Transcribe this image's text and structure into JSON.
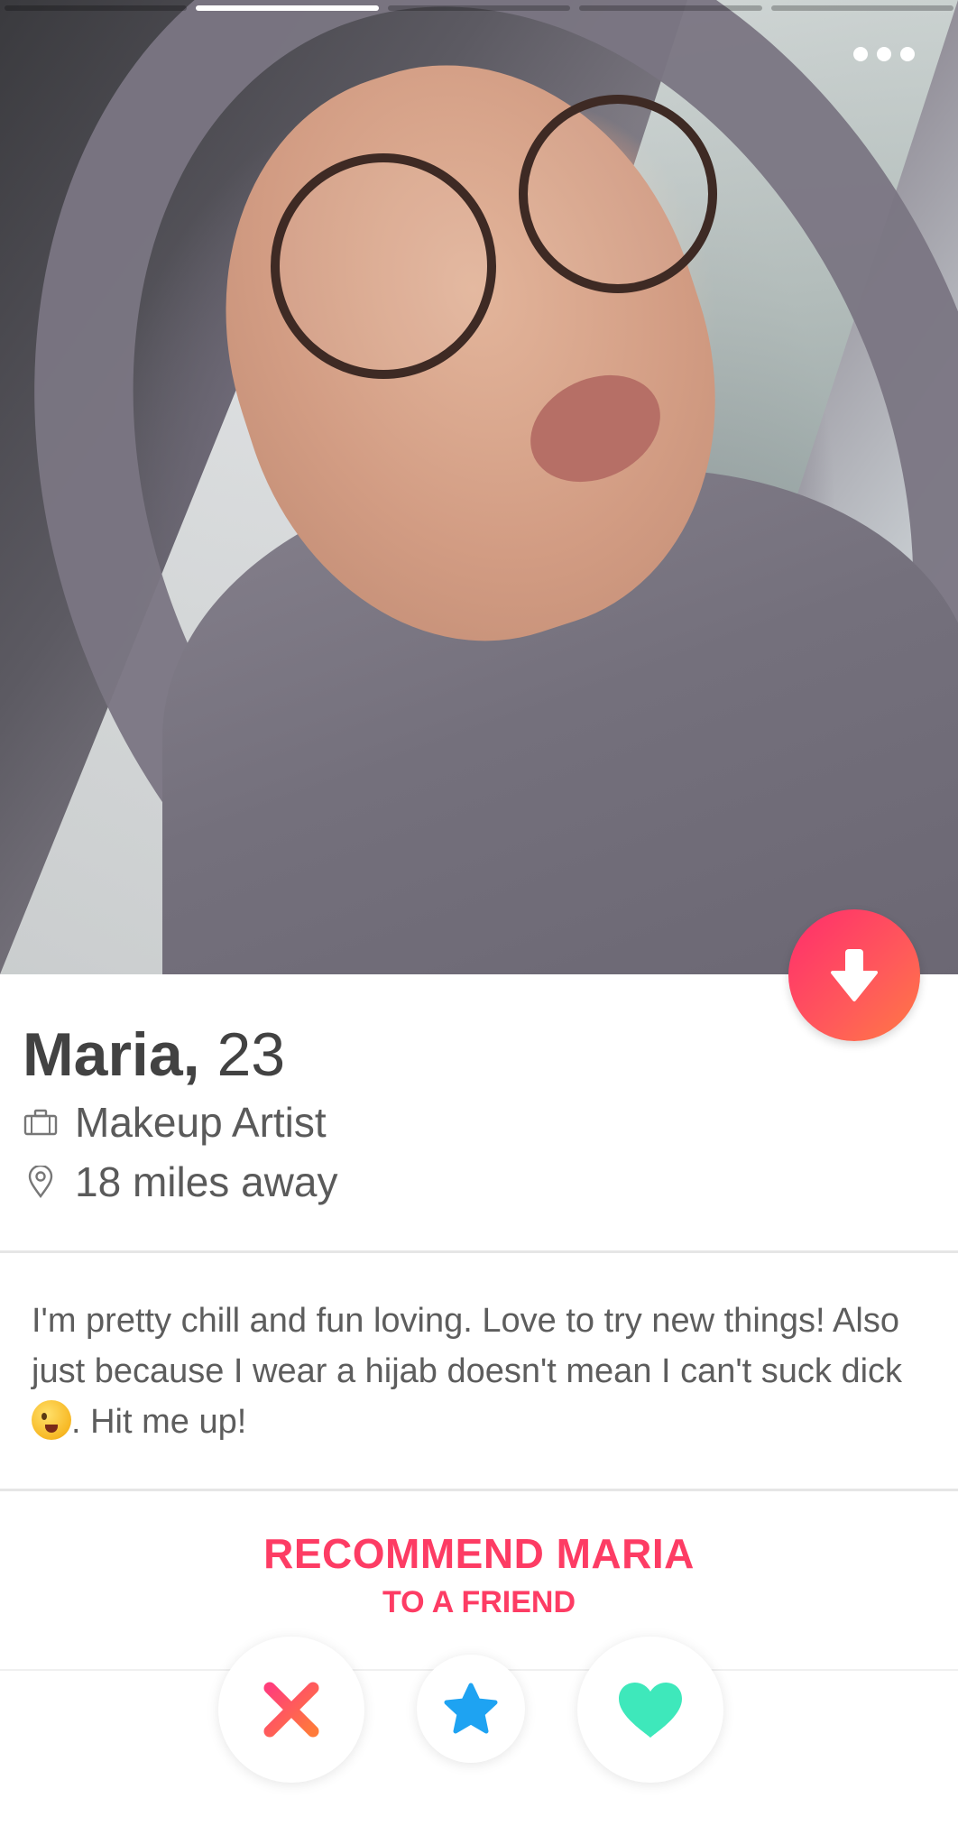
{
  "profile": {
    "name": "Maria,",
    "age": "23",
    "job": "Makeup Artist",
    "distance": "18 miles away",
    "bio_part1": "I'm pretty chill and fun loving. Love to try new things! Also just because I wear a hijab doesn't mean I can't suck dick ",
    "bio_emoji": "winking-face-emoji",
    "bio_part2": ". Hit me up!"
  },
  "photo_progress": {
    "total": 5,
    "active_index": 1
  },
  "recommend": {
    "line1": "RECOMMEND MARIA",
    "line2": "TO A FRIEND"
  },
  "icons": {
    "more": "ellipsis-icon",
    "collapse": "arrow-down-icon",
    "job": "briefcase-icon",
    "location": "location-pin-icon",
    "nope": "x-icon",
    "super_like": "star-icon",
    "like": "heart-icon"
  },
  "colors": {
    "brand_pink": "#fd3c64",
    "super_like_blue": "#1ea3f2",
    "like_teal": "#3ee8bb",
    "text_dark": "#424242",
    "text_gray": "#5d5d5d"
  }
}
